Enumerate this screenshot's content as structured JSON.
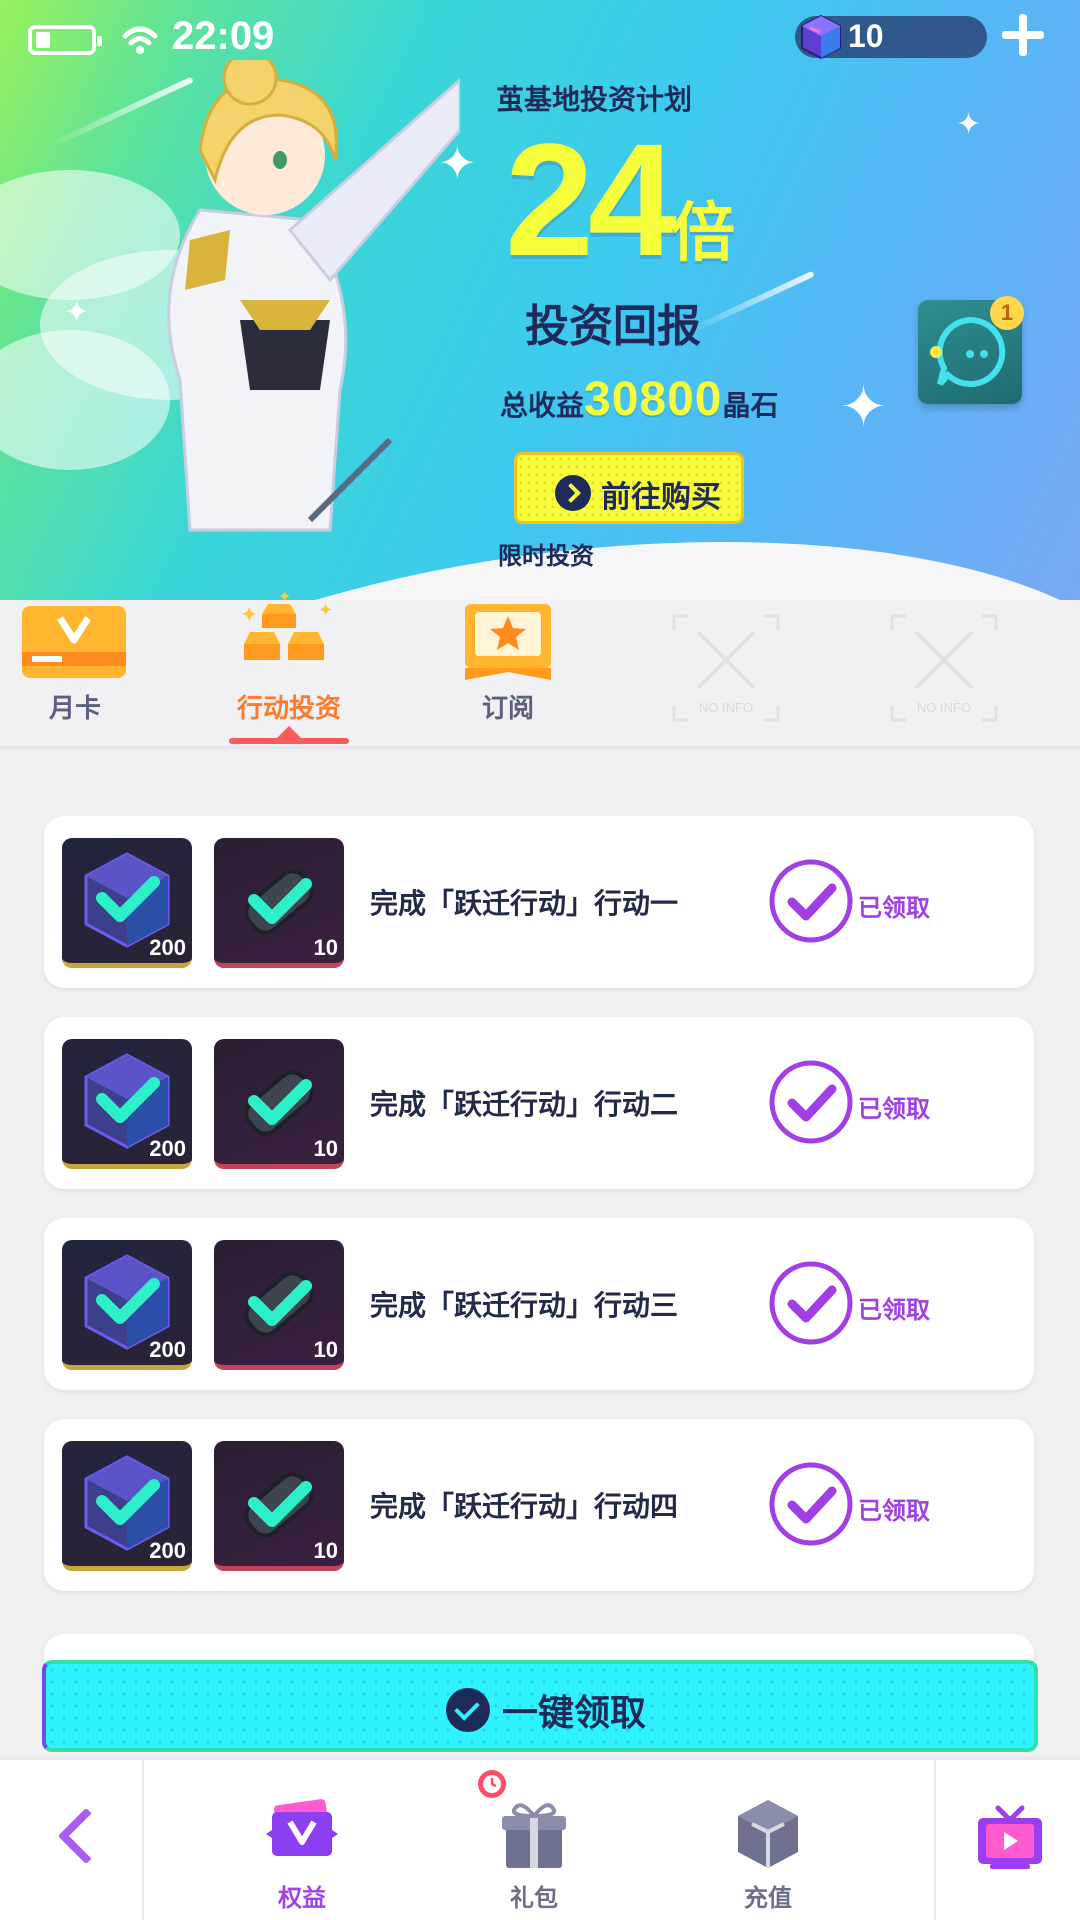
{
  "status_bar": {
    "time": "22:09",
    "currency": "10"
  },
  "hero": {
    "plan_title": "茧基地投资计划",
    "multiplier": "24",
    "multiplier_unit": "倍",
    "return_label": "投资回报",
    "total_label": "总收益",
    "total_amount": "30800",
    "total_unit": "晶石",
    "buy_button": "前往购买",
    "limited_label": "限时投资",
    "chat_badge": "1"
  },
  "tabs": [
    {
      "label": "月卡",
      "icon": "vip-card-icon",
      "active": false
    },
    {
      "label": "行动投资",
      "icon": "gold-bars-icon",
      "active": true
    },
    {
      "label": "订阅",
      "icon": "star-ribbon-icon",
      "active": false
    },
    {
      "label": "NO INFO",
      "icon": "no-info-icon",
      "active": false
    },
    {
      "label": "NO INFO",
      "icon": "no-info-icon",
      "active": false
    }
  ],
  "rows": [
    {
      "title": "完成「跃迁行动」行动一",
      "crystal_count": "200",
      "cell_count": "10",
      "status": "已领取"
    },
    {
      "title": "完成「跃迁行动」行动二",
      "crystal_count": "200",
      "cell_count": "10",
      "status": "已领取"
    },
    {
      "title": "完成「跃迁行动」行动三",
      "crystal_count": "200",
      "cell_count": "10",
      "status": "已领取"
    },
    {
      "title": "完成「跃迁行动」行动四",
      "crystal_count": "200",
      "cell_count": "10",
      "status": "已领取"
    }
  ],
  "claim_all": "一键领取",
  "bottom_nav": [
    {
      "label": "权益",
      "icon": "vip-ticket-icon",
      "active": true
    },
    {
      "label": "礼包",
      "icon": "gift-icon",
      "active": false
    },
    {
      "label": "充值",
      "icon": "cube-icon",
      "active": false
    }
  ],
  "colors": {
    "accent_purple": "#a13ee6",
    "highlight_yellow": "#f7ff3c",
    "claim_cyan": "#2ff2ff",
    "tab_active": "#ff7a2a"
  }
}
